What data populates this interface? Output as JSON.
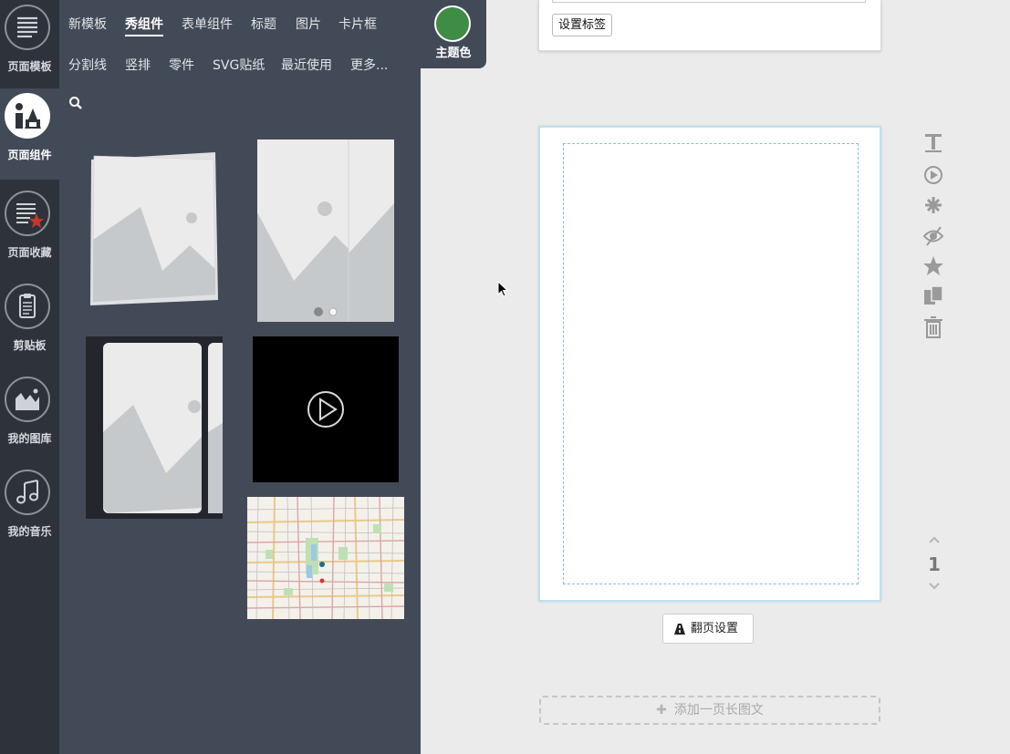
{
  "rail": {
    "items": [
      {
        "label": "页面模板",
        "icon": "list-icon"
      },
      {
        "label": "页面组件",
        "icon": "components-icon"
      },
      {
        "label": "页面收藏",
        "icon": "favorites-icon"
      },
      {
        "label": "剪贴板",
        "icon": "clipboard-icon"
      },
      {
        "label": "我的图库",
        "icon": "gallery-icon"
      },
      {
        "label": "我的音乐",
        "icon": "music-icon"
      }
    ]
  },
  "panel": {
    "tabs_row1": [
      "新模板",
      "秀组件",
      "表单组件",
      "标题",
      "图片",
      "卡片框"
    ],
    "tabs_row2": [
      "分割线",
      "竖排",
      "零件",
      "SVG贴纸",
      "最近使用",
      "更多..."
    ],
    "active_tab": "秀组件"
  },
  "theme": {
    "label": "主题色",
    "color": "#3f8c45"
  },
  "top_card": {
    "button_label": "设置标签"
  },
  "pager": {
    "page_number": "1"
  },
  "flip_button": {
    "label": "翻页设置"
  },
  "add_long": {
    "label": "添加一页长图文"
  },
  "colors": {
    "rail_bg": "#2e333b",
    "panel_bg": "#434a57",
    "accent_border": "#7fc3df"
  }
}
